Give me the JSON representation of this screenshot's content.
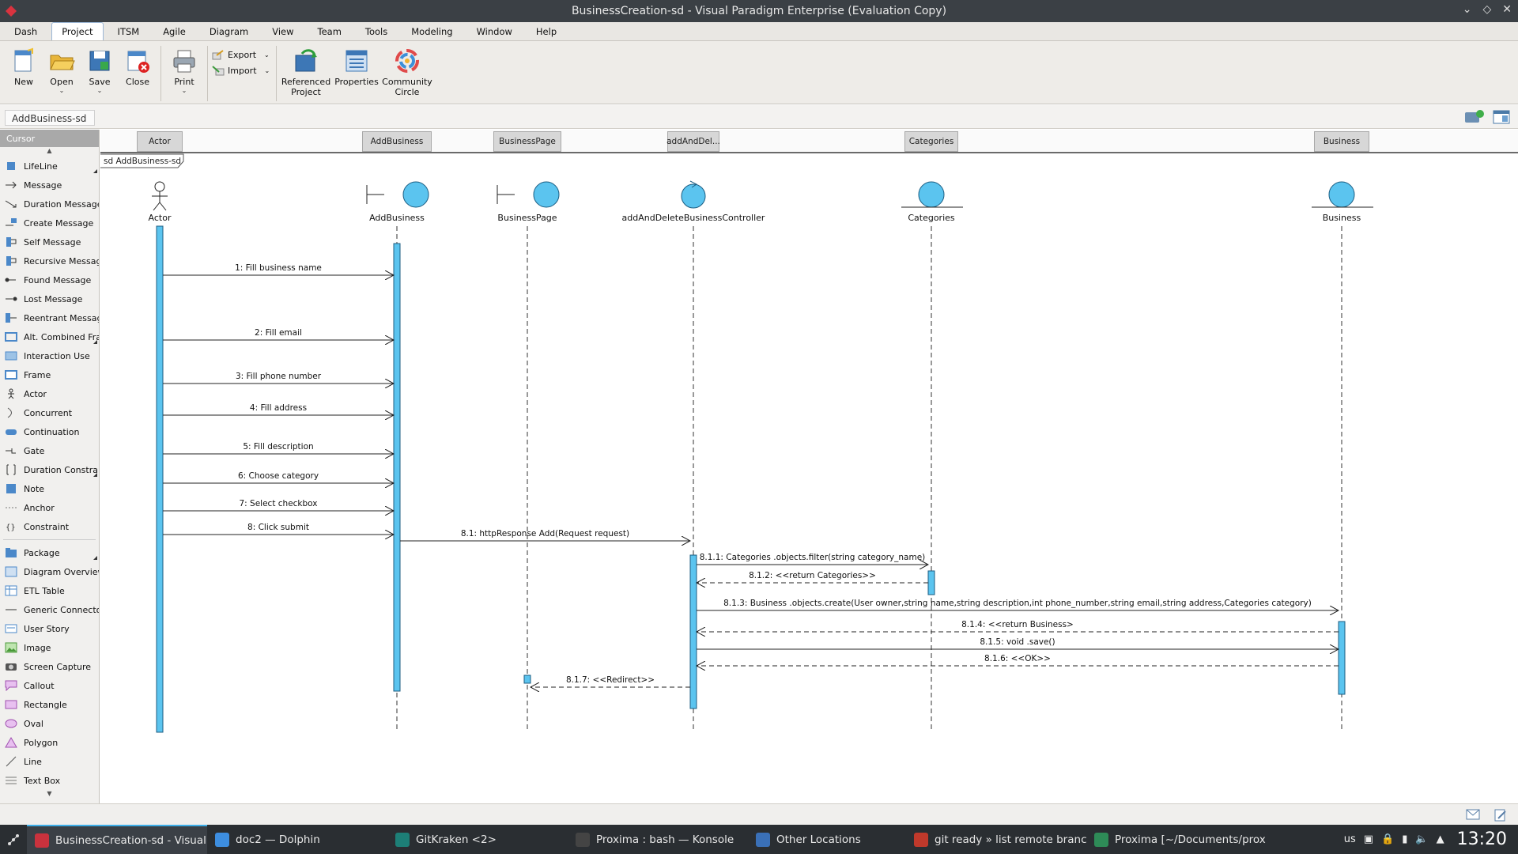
{
  "window": {
    "title": "BusinessCreation-sd - Visual Paradigm Enterprise (Evaluation Copy)"
  },
  "menu": [
    "Dash",
    "Project",
    "ITSM",
    "Agile",
    "Diagram",
    "View",
    "Team",
    "Tools",
    "Modeling",
    "Window",
    "Help"
  ],
  "menu_active": "Project",
  "ribbon": {
    "new": "New",
    "open": "Open",
    "save": "Save",
    "close": "Close",
    "print": "Print",
    "export": "Export",
    "import": "Import",
    "referenced_line1": "Referenced",
    "referenced_line2": "Project",
    "properties": "Properties",
    "community_line1": "Community",
    "community_line2": "Circle"
  },
  "breadcrumb": "AddBusiness-sd",
  "palette": {
    "cursor": "Cursor",
    "items": [
      "LifeLine",
      "Message",
      "Duration Message",
      "Create Message",
      "Self Message",
      "Recursive Message",
      "Found Message",
      "Lost Message",
      "Reentrant Message",
      "Alt. Combined Frag",
      "Interaction Use",
      "Frame",
      "Actor",
      "Concurrent",
      "Continuation",
      "Gate",
      "Duration Constraint",
      "Note",
      "Anchor",
      "Constraint"
    ],
    "items2": [
      "Package",
      "Diagram Overview",
      "ETL Table",
      "Generic Connector",
      "User Story",
      "Image",
      "Screen Capture",
      "Callout",
      "Rectangle",
      "Oval",
      "Polygon",
      "Line",
      "Text Box"
    ]
  },
  "lanes": [
    "Actor",
    "AddBusiness",
    "BusinessPage",
    "addAndDel...",
    "Categories",
    "Business"
  ],
  "frame_label": "sd AddBusiness-sd",
  "lifelines": [
    {
      "name": "Actor",
      "kind": "actor"
    },
    {
      "name": "AddBusiness",
      "kind": "boundary"
    },
    {
      "name": "BusinessPage",
      "kind": "boundary"
    },
    {
      "name": "addAndDeleteBusinessController",
      "kind": "control"
    },
    {
      "name": "Categories",
      "kind": "entity"
    },
    {
      "name": "Business",
      "kind": "entity"
    }
  ],
  "messages": [
    {
      "label": "1: Fill business name",
      "from": 0,
      "to": 1,
      "dashed": false
    },
    {
      "label": "2: Fill email",
      "from": 0,
      "to": 1,
      "dashed": false
    },
    {
      "label": "3: Fill phone number",
      "from": 0,
      "to": 1,
      "dashed": false
    },
    {
      "label": "4: Fill address",
      "from": 0,
      "to": 1,
      "dashed": false
    },
    {
      "label": "5: Fill description",
      "from": 0,
      "to": 1,
      "dashed": false
    },
    {
      "label": "6: Choose category",
      "from": 0,
      "to": 1,
      "dashed": false
    },
    {
      "label": "7: Select checkbox",
      "from": 0,
      "to": 1,
      "dashed": false
    },
    {
      "label": "8: Click submit",
      "from": 0,
      "to": 1,
      "dashed": false
    },
    {
      "label": "8.1: httpResponse Add(Request request)",
      "from": 1,
      "to": 3,
      "dashed": false
    },
    {
      "label": "8.1.1: Categories .objects.filter(string category_name)",
      "from": 3,
      "to": 4,
      "dashed": false
    },
    {
      "label": "8.1.2: <<return Categories>>",
      "from": 4,
      "to": 3,
      "dashed": true
    },
    {
      "label": "8.1.3: Business .objects.create(User owner,string name,string description,int phone_number,string email,string address,Categories category)",
      "from": 3,
      "to": 5,
      "dashed": false
    },
    {
      "label": "8.1.4: <<return Business>",
      "from": 5,
      "to": 3,
      "dashed": true
    },
    {
      "label": "8.1.5: void .save()",
      "from": 3,
      "to": 5,
      "dashed": false
    },
    {
      "label": "8.1.6: <<OK>>",
      "from": 5,
      "to": 3,
      "dashed": true
    },
    {
      "label": "8.1.7: <<Redirect>>",
      "from": 3,
      "to": 2,
      "dashed": true
    }
  ],
  "colors": {
    "lifeline_fill": "#5bc4ef",
    "lifeline_stroke": "#1c5d82",
    "activation": "#5bc4ef"
  },
  "taskbar": {
    "tasks": [
      "BusinessCreation-sd - Visual P...",
      "doc2 — Dolphin",
      "GitKraken <2>",
      "Proxima : bash — Konsole",
      "Other Locations",
      "git ready » list remote branch...",
      "Proxima [~/Documents/proxi..."
    ],
    "keyboard": "us",
    "clock": "13:20"
  }
}
